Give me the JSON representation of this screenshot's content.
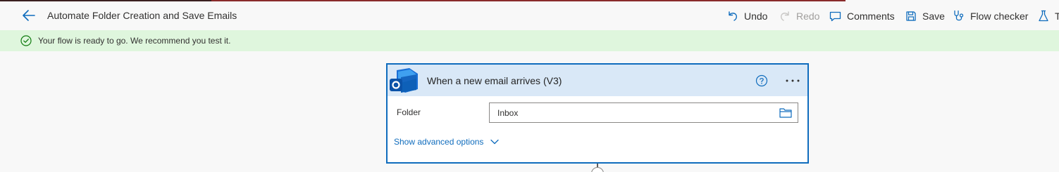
{
  "header": {
    "title": "Automate Folder Creation and Save Emails",
    "back_icon": "arrow-left-icon",
    "commands": {
      "undo": "Undo",
      "redo": "Redo",
      "comments": "Comments",
      "save": "Save",
      "flow_checker": "Flow checker",
      "test": "T"
    }
  },
  "banner": {
    "message": "Your flow is ready to go. We recommend you test it.",
    "icon": "checkmark-circle-icon",
    "color": "#dff6dd"
  },
  "trigger_card": {
    "title": "When a new email arrives (V3)",
    "icon": "outlook-logo-icon",
    "field": {
      "label": "Folder",
      "value": "Inbox"
    },
    "advanced_options": "Show advanced options",
    "accent_color": "#0f6cbd"
  }
}
